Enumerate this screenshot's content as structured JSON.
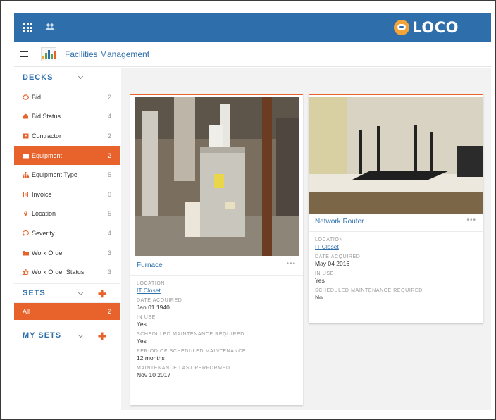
{
  "brand": {
    "name": "LOCO"
  },
  "header": {
    "app_title": "Facilities Management"
  },
  "sidebar": {
    "decks_title": "DECKS",
    "decks": [
      {
        "label": "Bid",
        "count": "2",
        "icon": "handshake-icon"
      },
      {
        "label": "Bid Status",
        "count": "4",
        "icon": "status-icon"
      },
      {
        "label": "Contractor",
        "count": "2",
        "icon": "contractor-icon"
      },
      {
        "label": "Equipment",
        "count": "2",
        "icon": "folder-icon",
        "active": true
      },
      {
        "label": "Equipment Type",
        "count": "5",
        "icon": "hierarchy-icon"
      },
      {
        "label": "Invoice",
        "count": "0",
        "icon": "invoice-icon"
      },
      {
        "label": "Location",
        "count": "5",
        "icon": "map-pin-icon"
      },
      {
        "label": "Severity",
        "count": "4",
        "icon": "speech-bubble-icon"
      },
      {
        "label": "Work Order",
        "count": "3",
        "icon": "folder-icon"
      },
      {
        "label": "Work Order Status",
        "count": "3",
        "icon": "thumbs-up-icon"
      }
    ],
    "sets_title": "SETS",
    "sets": [
      {
        "label": "All",
        "count": "2"
      }
    ],
    "my_sets_title": "MY SETS"
  },
  "cards": [
    {
      "name": "Furnace",
      "fields": [
        {
          "label": "LOCATION",
          "value": "IT Closet",
          "link": true
        },
        {
          "label": "DATE ACQUIRED",
          "value": "Jan 01 1940"
        },
        {
          "label": "IN USE",
          "value": "Yes"
        },
        {
          "label": "SCHEDULED MAINTENANCE REQUIRED",
          "value": "Yes"
        },
        {
          "label": "PERIOD OF SCHEDULED MAINTENANCE",
          "value": "12 months"
        },
        {
          "label": "MAINTENANCE LAST PERFORMED",
          "value": "Nov 10 2017"
        }
      ]
    },
    {
      "name": "Network Router",
      "fields": [
        {
          "label": "LOCATION",
          "value": "IT Closet",
          "link": true
        },
        {
          "label": "DATE ACQUIRED",
          "value": "May 04 2016"
        },
        {
          "label": "IN USE",
          "value": "Yes"
        },
        {
          "label": "SCHEDULED MAINTENANCE REQUIRED",
          "value": "No"
        }
      ]
    }
  ],
  "colors": {
    "topbar": "#2e6fab",
    "accent": "#e8632b",
    "link": "#2e6fab"
  }
}
